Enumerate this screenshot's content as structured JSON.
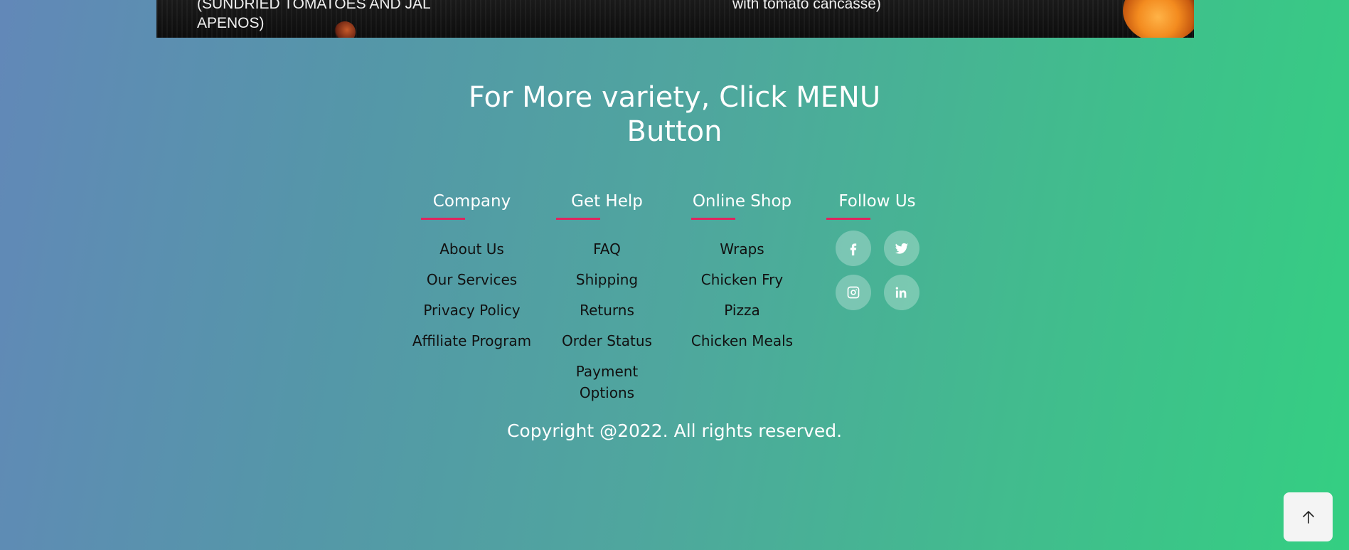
{
  "banner": {
    "left_caption": "(SUNDRIED TOMATOES AND JAL APENOS)",
    "right_caption": "with tomato cancasse)"
  },
  "cta": {
    "title": "For More variety, Click MENU Button"
  },
  "footer": {
    "columns": [
      {
        "heading": "Company",
        "links": [
          "About Us",
          "Our Services",
          "Privacy Policy",
          "Affiliate Program"
        ]
      },
      {
        "heading": "Get Help",
        "links": [
          "FAQ",
          "Shipping",
          "Returns",
          "Order Status",
          "Payment Options"
        ]
      },
      {
        "heading": "Online Shop",
        "links": [
          "Wraps",
          "Chicken Fry",
          "Pizza",
          "Chicken Meals"
        ]
      },
      {
        "heading": "Follow Us",
        "social": [
          "facebook-icon",
          "twitter-icon",
          "instagram-icon",
          "linkedin-icon"
        ]
      }
    ],
    "copyright": "Copyright @2022. All rights reserved."
  },
  "colors": {
    "accent_underline": "#e0245e",
    "gradient_start": "#6288b8",
    "gradient_end": "#34cf82"
  },
  "scroll_top": {
    "icon": "arrow-up-icon"
  }
}
